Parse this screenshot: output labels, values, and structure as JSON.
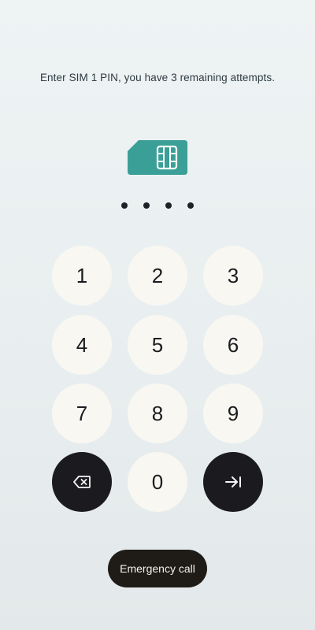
{
  "prompt_text": "Enter SIM 1 PIN, you have 3 remaining attempts.",
  "sim_icon": "sim-card-icon",
  "pin_dots": 4,
  "keypad": {
    "keys": [
      "1",
      "2",
      "3",
      "4",
      "5",
      "6",
      "7",
      "8",
      "9",
      "0"
    ],
    "backspace_icon": "backspace-icon",
    "enter_icon": "enter-arrow-icon"
  },
  "emergency_call_label": "Emergency call",
  "colors": {
    "accent": "#3a9f96",
    "key_light": "#f8f7f2",
    "key_dark": "#1b1a1e",
    "emergency_bg": "#1f1b16"
  }
}
